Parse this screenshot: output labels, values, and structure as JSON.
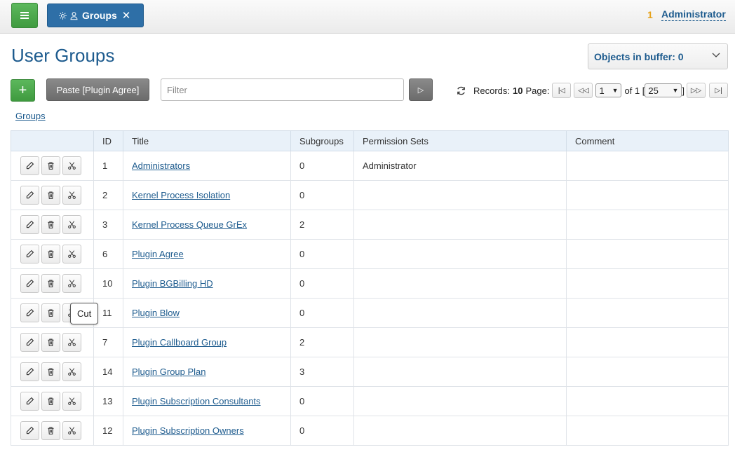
{
  "topbar": {
    "tab": {
      "label": "Groups"
    },
    "user": {
      "count": "1",
      "name": "Administrator"
    }
  },
  "page": {
    "title": "User Groups"
  },
  "buffer": {
    "label": "Objects in buffer: 0"
  },
  "toolbar": {
    "paste_label": "Paste [Plugin Agree]",
    "filter_placeholder": "Filter"
  },
  "pager": {
    "records_label": "Records:",
    "records_count": "10",
    "page_label": "Page:",
    "page_value": "1",
    "of_label": "of 1 [",
    "page_size": "25",
    "close_bracket": "]"
  },
  "breadcrumb": {
    "label": "Groups"
  },
  "table": {
    "headers": [
      "",
      "ID",
      "Title",
      "Subgroups",
      "Permission Sets",
      "Comment"
    ],
    "rows": [
      {
        "id": "1",
        "title": "Administrators",
        "subgroups": "0",
        "permsets": "Administrator",
        "comment": ""
      },
      {
        "id": "2",
        "title": "Kernel Process Isolation",
        "subgroups": "0",
        "permsets": "",
        "comment": ""
      },
      {
        "id": "3",
        "title": "Kernel Process Queue GrEx",
        "subgroups": "2",
        "permsets": "",
        "comment": ""
      },
      {
        "id": "6",
        "title": "Plugin Agree",
        "subgroups": "0",
        "permsets": "",
        "comment": ""
      },
      {
        "id": "10",
        "title": "Plugin BGBilling HD",
        "subgroups": "0",
        "permsets": "",
        "comment": ""
      },
      {
        "id": "11",
        "title": "Plugin Blow",
        "subgroups": "0",
        "permsets": "",
        "comment": ""
      },
      {
        "id": "7",
        "title": "Plugin Callboard Group",
        "subgroups": "2",
        "permsets": "",
        "comment": ""
      },
      {
        "id": "14",
        "title": "Plugin Group Plan",
        "subgroups": "3",
        "permsets": "",
        "comment": ""
      },
      {
        "id": "13",
        "title": "Plugin Subscription Consultants",
        "subgroups": "0",
        "permsets": "",
        "comment": ""
      },
      {
        "id": "12",
        "title": "Plugin Subscription Owners",
        "subgroups": "0",
        "permsets": "",
        "comment": ""
      }
    ]
  },
  "tooltip": {
    "label": "Cut"
  },
  "colors": {
    "accent": "#1d5b8e",
    "green": "#4cae4c",
    "tab": "#2e6fa7",
    "badge": "#e6a21a"
  },
  "icons": [
    "menu-icon",
    "gear-icon",
    "user-icon",
    "close-icon",
    "chevron-down-icon",
    "plus-icon",
    "play-icon",
    "refresh-icon",
    "first-page-icon",
    "prev-page-icon",
    "next-page-icon",
    "last-page-icon",
    "pencil-icon",
    "trash-icon",
    "scissors-icon"
  ]
}
